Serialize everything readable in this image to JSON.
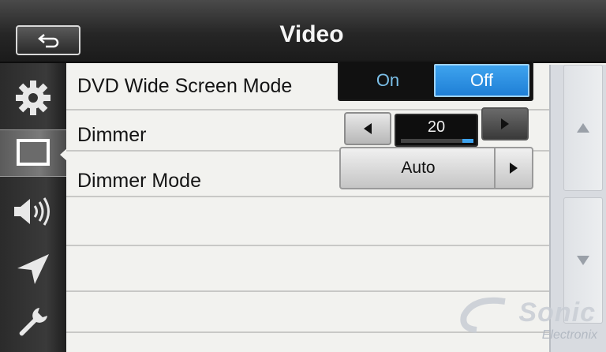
{
  "title": "Video",
  "back_button": {
    "icon": "back-arrow-icon"
  },
  "sidebar": {
    "items": [
      {
        "name": "settings",
        "icon": "gear-icon",
        "active": false
      },
      {
        "name": "video",
        "icon": "screen-icon",
        "active": true
      },
      {
        "name": "audio",
        "icon": "speaker-icon",
        "active": false
      },
      {
        "name": "navigation",
        "icon": "navigation-arrow-icon",
        "active": false
      },
      {
        "name": "tools",
        "icon": "wrench-icon",
        "active": false
      }
    ]
  },
  "settings": {
    "wide_screen": {
      "label": "DVD Wide Screen Mode",
      "options": [
        "On",
        "Off"
      ],
      "selected": "Off"
    },
    "dimmer": {
      "label": "Dimmer",
      "value": "20",
      "level": 0.15
    },
    "dimmer_mode": {
      "label": "Dimmer Mode",
      "value": "Auto"
    }
  },
  "scroll": {
    "up_icon": "triangle-up-icon",
    "down_icon": "triangle-down-icon"
  },
  "watermark": {
    "brand": "Sonic",
    "sub": "Electronix"
  },
  "colors": {
    "accent": "#2b8ee0",
    "titlebar": "#262626",
    "list_bg": "#f2f2ef"
  }
}
